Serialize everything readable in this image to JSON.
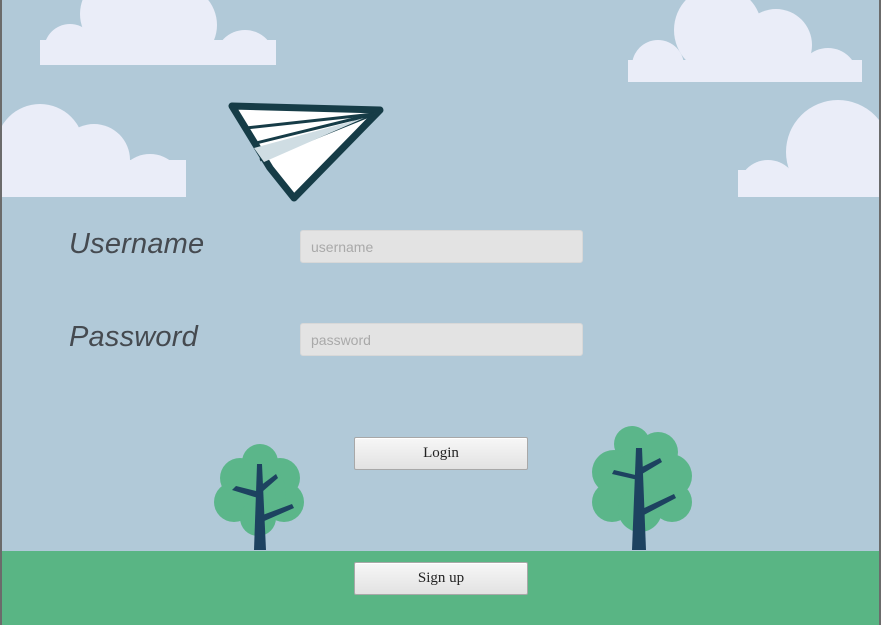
{
  "form": {
    "username_label": "Username",
    "username_placeholder": "username",
    "password_label": "Password",
    "password_placeholder": "password",
    "login_label": "Login",
    "signup_label": "Sign up"
  },
  "colors": {
    "sky": "#b1c9d8",
    "ground": "#59b584",
    "cloud": "#eaedf8",
    "plane_outline": "#163c47",
    "tree_foliage": "#5bb68a",
    "tree_trunk": "#1d4260"
  }
}
